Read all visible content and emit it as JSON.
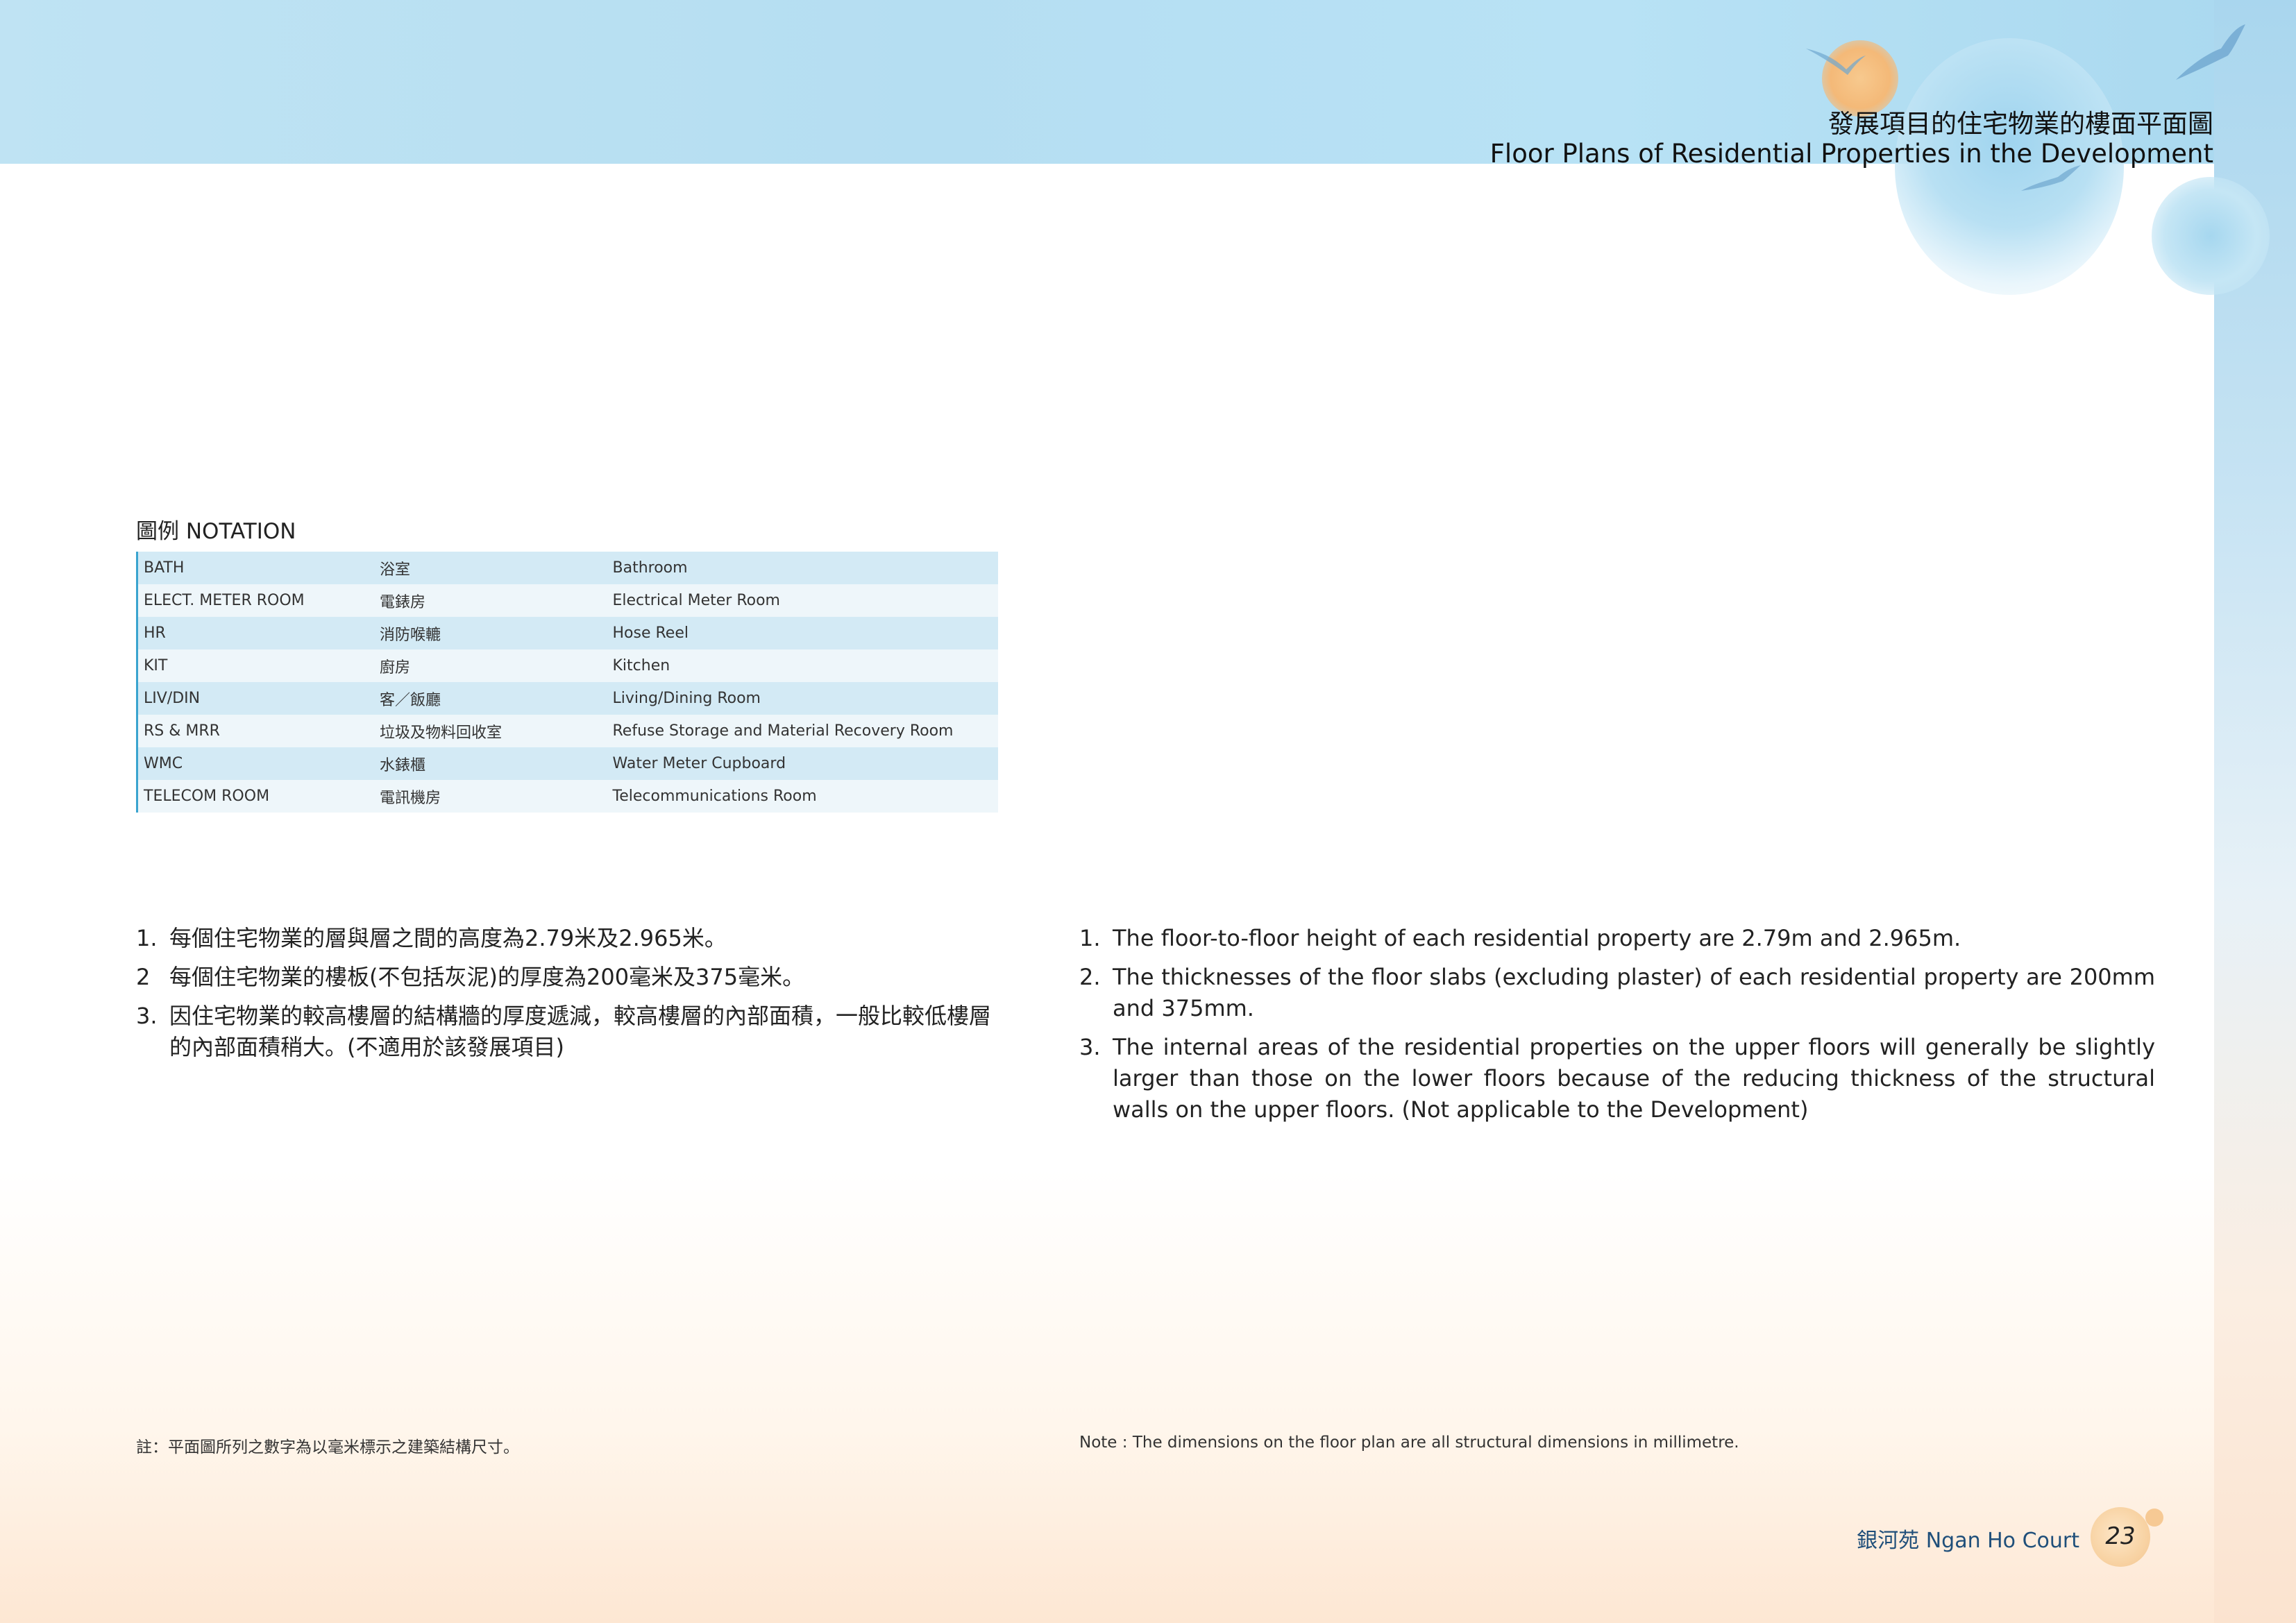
{
  "header": {
    "title_zh": "發展項目的住宅物業的樓面平面圖",
    "title_en": "Floor Plans of Residential Properties in the Development"
  },
  "notation": {
    "title": "圖例 NOTATION",
    "rows": [
      {
        "abbr": "BATH",
        "zh": "浴室",
        "en": "Bathroom"
      },
      {
        "abbr": "ELECT. METER ROOM",
        "zh": "電錶房",
        "en": "Electrical Meter Room"
      },
      {
        "abbr": "HR",
        "zh": "消防喉轆",
        "en": "Hose Reel"
      },
      {
        "abbr": "KIT",
        "zh": "廚房",
        "en": "Kitchen"
      },
      {
        "abbr": "LIV/DIN",
        "zh": "客／飯廳",
        "en": "Living/Dining Room"
      },
      {
        "abbr": "RS & MRR",
        "zh": "垃圾及物料回收室",
        "en": "Refuse Storage and Material Recovery Room"
      },
      {
        "abbr": "WMC",
        "zh": "水錶櫃",
        "en": "Water Meter Cupboard"
      },
      {
        "abbr": "TELECOM ROOM",
        "zh": "電訊機房",
        "en": "Telecommunications Room"
      }
    ]
  },
  "notes_zh": [
    {
      "num": "1.",
      "text": "每個住宅物業的層與層之間的高度為2.79米及2.965米。"
    },
    {
      "num": "2",
      "text": "每個住宅物業的樓板(不包括灰泥)的厚度為200毫米及375毫米。"
    },
    {
      "num": "3.",
      "text": "因住宅物業的較高樓層的結構牆的厚度遞減，較高樓層的內部面積，一般比較低樓層的內部面積稍大。(不適用於該發展項目)"
    }
  ],
  "notes_en": [
    {
      "num": "1.",
      "text": "The floor-to-floor height of each residential property are 2.79m and 2.965m."
    },
    {
      "num": "2.",
      "text": "The thicknesses of the floor slabs (excluding plaster) of each residential property are 200mm and 375mm."
    },
    {
      "num": "3.",
      "text": "The internal areas of the residential properties on the upper floors will generally be slightly larger than those on the lower floors because of the reducing thickness of the structural walls on the upper floors. (Not applicable to the Development)"
    }
  ],
  "footnote": {
    "zh": "註：平面圖所列之數字為以毫米標示之建築結構尺寸。",
    "en": "Note : The dimensions on the floor plan are all structural dimensions in millimetre."
  },
  "footer": {
    "name": "銀河苑  Ngan Ho Court",
    "page": "23"
  },
  "colors": {
    "table_row_dark": "#d3eaf5",
    "table_row_light": "#eef6fa",
    "table_accent": "#3aa4cf",
    "footer_text": "#1f4f7a"
  }
}
